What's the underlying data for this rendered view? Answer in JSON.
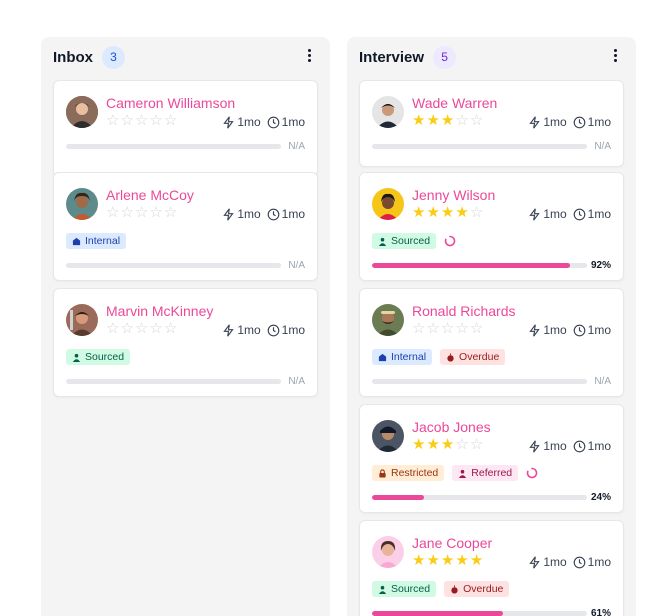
{
  "columns": [
    {
      "title": "Inbox",
      "count": "3",
      "cards": [
        {
          "name": "Cameron Williamson",
          "rating": 0,
          "activity": "1mo",
          "age": "1mo",
          "tags": [],
          "progress_label": "N/A",
          "progress": 0
        },
        {
          "name": "Arlene McCoy",
          "rating": 0,
          "activity": "1mo",
          "age": "1mo",
          "tags": [
            "Internal"
          ],
          "progress_label": "N/A",
          "progress": 0
        },
        {
          "name": "Marvin McKinney",
          "rating": 0,
          "activity": "1mo",
          "age": "1mo",
          "tags": [
            "Sourced"
          ],
          "progress_label": "N/A",
          "progress": 0
        }
      ]
    },
    {
      "title": "Interview",
      "count": "5",
      "cards": [
        {
          "name": "Wade Warren",
          "rating": 3,
          "activity": "1mo",
          "age": "1mo",
          "tags": [],
          "progress_label": "N/A",
          "progress": 0
        },
        {
          "name": "Jenny Wilson",
          "rating": 4,
          "activity": "1mo",
          "age": "1mo",
          "tags": [
            "Sourced"
          ],
          "progress_label": "92%",
          "progress": 92
        },
        {
          "name": "Ronald Richards",
          "rating": 0,
          "activity": "1mo",
          "age": "1mo",
          "tags": [
            "Internal",
            "Overdue"
          ],
          "progress_label": "N/A",
          "progress": 0
        },
        {
          "name": "Jacob Jones",
          "rating": 3,
          "activity": "1mo",
          "age": "1mo",
          "tags": [
            "Restricted",
            "Referred"
          ],
          "progress_label": "24%",
          "progress": 24
        },
        {
          "name": "Jane Cooper",
          "rating": 5,
          "activity": "1mo",
          "age": "1mo",
          "tags": [
            "Sourced",
            "Overdue"
          ],
          "progress_label": "61%",
          "progress": 61
        }
      ]
    }
  ],
  "colors": {
    "accent": "#ec4899",
    "star_on": "#facc15",
    "star_off": "#d1d5db"
  }
}
